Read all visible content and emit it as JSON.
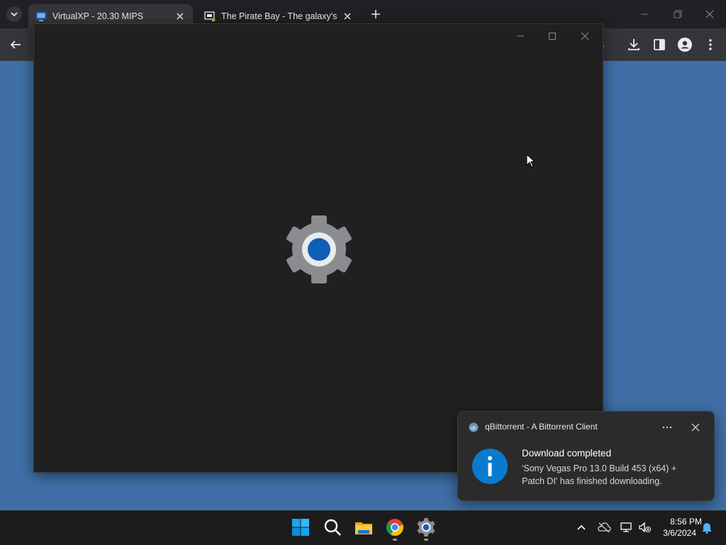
{
  "browser": {
    "tabs": [
      {
        "title": "VirtualXP - 20.30 MIPS",
        "active": true
      },
      {
        "title": "The Pirate Bay - The galaxy's m",
        "active": false
      }
    ]
  },
  "notification": {
    "app": "qBittorrent - A Bittorrent Client",
    "title": "Download completed",
    "body": "'Sony Vegas Pro 13.0 Build 453 (x64) + Patch DI' has finished downloading."
  },
  "taskbar": {
    "apps": [
      "start-icon",
      "search-icon",
      "file-explorer-icon",
      "chrome-icon",
      "settings-icon"
    ],
    "clock": {
      "time": "8:56 PM",
      "date": "3/6/2024"
    }
  },
  "colors": {
    "desktop": "#3f6fa6",
    "window": "#202020",
    "accent": "#0a7acf"
  }
}
